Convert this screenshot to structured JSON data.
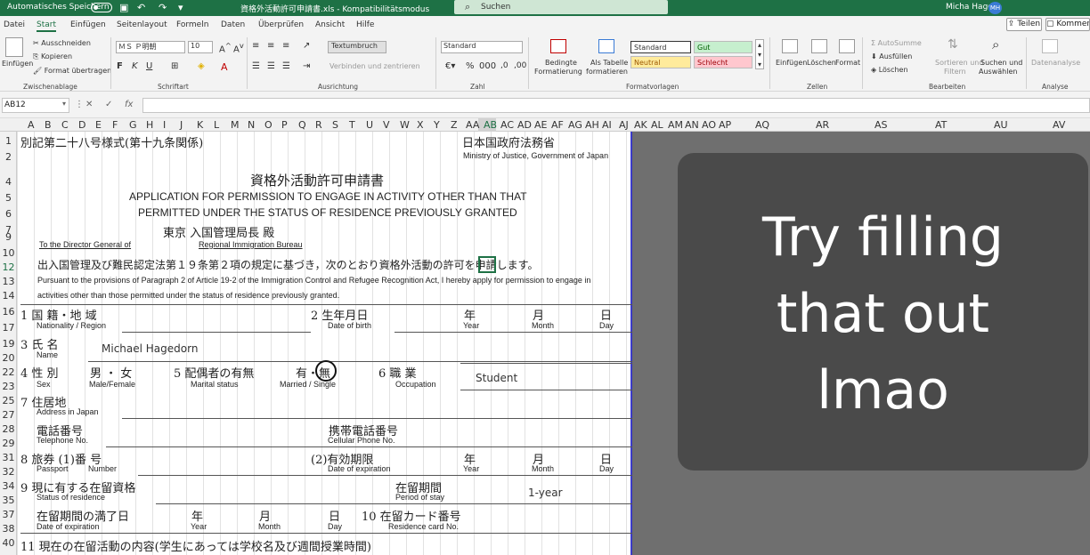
{
  "titlebar": {
    "autosave": "Automatisches Speichern",
    "doc_title": "資格外活動許可申請書.xls  -  Kompatibilitätsmodus",
    "search": "Suchen",
    "user": "Micha Hage",
    "avatar": "MH"
  },
  "menu": [
    "Datei",
    "Start",
    "Einfügen",
    "Seitenlayout",
    "Formeln",
    "Daten",
    "Überprüfen",
    "Ansicht",
    "Hilfe"
  ],
  "share": "Teilen",
  "comments": "Kommentare",
  "ribbon": {
    "paste": "Einfügen",
    "cut": "Ausschneiden",
    "copy": "Kopieren",
    "format_painter": "Format übertragen",
    "clipboard": "Zwischenablage",
    "font_name": "ＭＳ Ｐ明朝",
    "font_size": "10",
    "font": "Schriftart",
    "wrap": "Textumbruch",
    "merge": "Verbinden und zentrieren",
    "alignment": "Ausrichtung",
    "number_format": "Standard",
    "number": "Zahl",
    "cond_format_1": "Bedingte",
    "cond_format_2": "Formatierung",
    "as_table_1": "Als Tabelle",
    "as_table_2": "formatieren",
    "style_standard": "Standard",
    "style_good": "Gut",
    "style_neutral": "Neutral",
    "style_bad": "Schlecht",
    "styles": "Formatvorlagen",
    "insert": "Einfügen",
    "delete": "Löschen",
    "format": "Format",
    "cells": "Zellen",
    "autosum": "AutoSumme",
    "fill": "Ausfüllen",
    "clear": "Löschen",
    "sort_1": "Sortieren und",
    "sort_2": "Filtern",
    "find_1": "Suchen und",
    "find_2": "Auswählen",
    "editing": "Bearbeiten",
    "data_analysis": "Datenanalyse",
    "analysis": "Analyse"
  },
  "formula": {
    "name_box": "AB12",
    "fx": "fx"
  },
  "columns": [
    "A",
    "B",
    "C",
    "D",
    "E",
    "F",
    "G",
    "H",
    "I",
    "J",
    "K",
    "L",
    "M",
    "N",
    "O",
    "P",
    "Q",
    "R",
    "S",
    "T",
    "U",
    "V",
    "W",
    "X",
    "Y",
    "Z",
    "AA",
    "AB",
    "AC",
    "AD",
    "AE",
    "AF",
    "AG",
    "AH",
    "AI",
    "AJ",
    "AK",
    "AL",
    "AM",
    "AN",
    "AO",
    "AP",
    "AQ",
    "AR",
    "AS",
    "AT",
    "AU",
    "AV"
  ],
  "rows": [
    "1",
    "2",
    "4",
    "5",
    "6",
    "7",
    "9",
    "10",
    "12",
    "13",
    "14",
    "16",
    "17",
    "19",
    "20",
    "22",
    "23",
    "25",
    "27",
    "28",
    "29",
    "31",
    "32",
    "34",
    "35",
    "37",
    "38",
    "40"
  ],
  "form": {
    "header_jp": "別記第二十八号様式(第十九条関係)",
    "ministry_jp": "日本国政府法務省",
    "ministry_en": "Ministry of Justice, Government of Japan",
    "title_jp": "資格外活動許可申請書",
    "title_en_1": "APPLICATION FOR PERMISSION TO ENGAGE IN ACTIVITY OTHER THAN THAT",
    "title_en_2": "PERMITTED UNDER THE STATUS OF RESIDENCE PREVIOUSLY GRANTED",
    "bureau_jp": "東京  入国管理局長      殿",
    "director_en": "To the Director General of",
    "bureau_en": "Regional Immigration Bureau",
    "intro_jp": "出入国管理及び難民認定法第１９条第２項の規定に基づき，次のとおり資格外活動の許可を申請します。",
    "intro_en_1": "Pursuant to the provisions of Paragraph 2 of Article 19-2 of the Immigration Control and Refugee Recognition Act, I hereby apply for permission to engage in",
    "intro_en_2": "activities other than those permitted under the status of residence previously granted.",
    "f1_jp": "1  国  籍・地  域",
    "f1_en": "Nationality / Region",
    "f2_jp": "2  生年月日",
    "f2_en": "Date of birth",
    "year_jp": "年",
    "year_en": "Year",
    "month_jp": "月",
    "month_en": "Month",
    "day_jp": "日",
    "day_en": "Day",
    "f3_jp": "3  氏  名",
    "f3_en": "Name",
    "name_value": "Michael Hagedorn",
    "f4_jp": "4  性  別",
    "f4_en": "Sex",
    "sex_options_jp": "男 ・ 女",
    "sex_options_en": "Male/Female",
    "f5_jp": "5  配偶者の有無",
    "f5_en": "Marital status",
    "marital_jp": "有・無",
    "marital_en": "Married / Single",
    "f6_jp": "6  職  業",
    "f6_en": "Occupation",
    "occupation_value": "Student",
    "f7_jp": "7  住居地",
    "f7_en": "Address in Japan",
    "phone_jp": "電話番号",
    "phone_en": "Telephone No.",
    "cell_jp": "携帯電話番号",
    "cell_en": "Cellular Phone No.",
    "f8_jp": "8  旅券  (1)番  号",
    "f8_en_1": "Passport",
    "f8_en_2": "Number",
    "expiry_jp": "(2)有効期限",
    "expiry_en": "Date of expiration",
    "f9_jp": "9  現に有する在留資格",
    "f9_en": "Status of residence",
    "period_jp": "在留期間",
    "period_en": "Period of stay",
    "period_value": "1-year",
    "expiry2_jp": "在留期間の満了日",
    "expiry2_en": "Date of expiration",
    "f10_jp": "10  在留カード番号",
    "f10_en": "Residence card No.",
    "f11_jp": "11  現在の在留活動の内容(学生にあっては学校名及び週間授業時間)"
  },
  "overlay": {
    "line1": "Try filling",
    "line2": "that out",
    "line3": "lmao"
  }
}
